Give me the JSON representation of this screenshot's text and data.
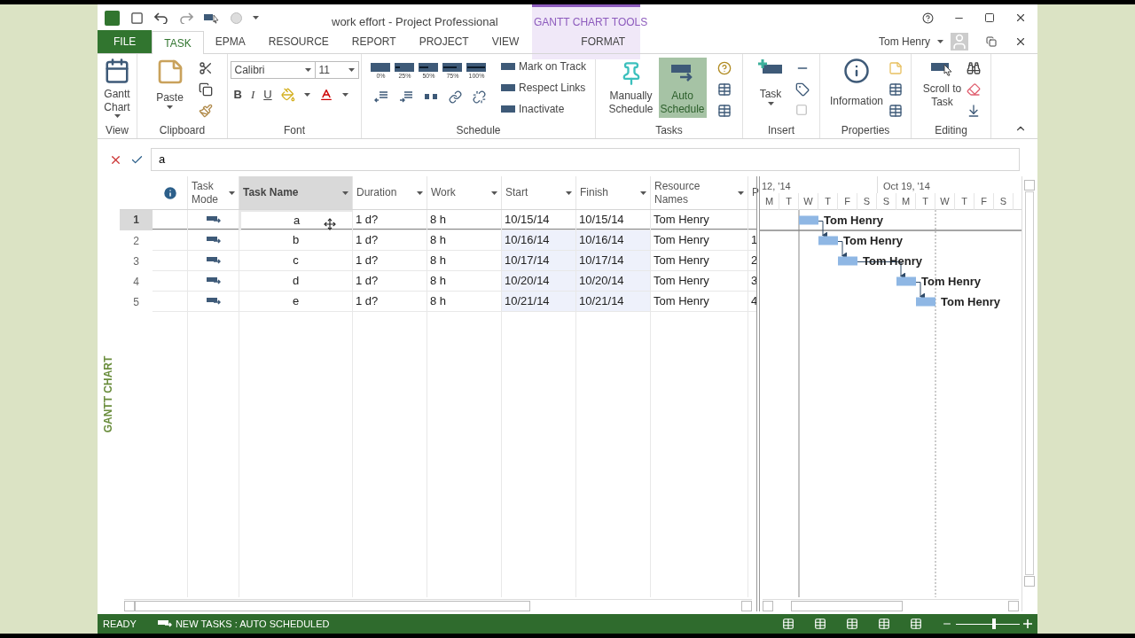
{
  "window": {
    "title": "work effort - Project Professional",
    "context_title": "GANTT CHART TOOLS",
    "user": "Tom Henry"
  },
  "tabs": [
    {
      "label": "FILE",
      "kind": "file",
      "selected": false
    },
    {
      "label": "TASK",
      "kind": "tab",
      "selected": true
    },
    {
      "label": "EPMA",
      "kind": "tab",
      "selected": false
    },
    {
      "label": "RESOURCE",
      "kind": "tab",
      "selected": false
    },
    {
      "label": "REPORT",
      "kind": "tab",
      "selected": false
    },
    {
      "label": "PROJECT",
      "kind": "tab",
      "selected": false
    },
    {
      "label": "VIEW",
      "kind": "tab",
      "selected": false
    },
    {
      "label": "FORMAT",
      "kind": "context",
      "selected": false
    }
  ],
  "ribbon": {
    "view": {
      "label": "View",
      "button": "Gantt Chart"
    },
    "clipboard": {
      "label": "Clipboard",
      "button": "Paste"
    },
    "font": {
      "label": "Font",
      "font_name": "Calibri",
      "font_size": "11",
      "format_buttons": [
        "B",
        "I",
        "U"
      ]
    },
    "schedule": {
      "label": "Schedule",
      "percents": [
        "0%",
        "25%",
        "50%",
        "75%",
        "100%"
      ],
      "commands": [
        "Mark on Track",
        "Respect Links",
        "Inactivate"
      ]
    },
    "tasks": {
      "label": "Tasks",
      "modes": [
        {
          "label": "Manually Schedule",
          "selected": false
        },
        {
          "label": "Auto Schedule",
          "selected": true
        }
      ]
    },
    "insert": {
      "label": "Insert",
      "button": "Task"
    },
    "properties": {
      "label": "Properties",
      "button": "Information"
    },
    "editing": {
      "label": "Editing",
      "button": "Scroll to Task"
    }
  },
  "entry_bar": {
    "value": "a"
  },
  "side_label": "GANTT CHART",
  "table": {
    "columns": [
      {
        "label": "Task Mode",
        "selected": false
      },
      {
        "label": "Task Name",
        "selected": true
      },
      {
        "label": "Duration",
        "selected": false
      },
      {
        "label": "Work",
        "selected": false
      },
      {
        "label": "Start",
        "selected": false
      },
      {
        "label": "Finish",
        "selected": false
      },
      {
        "label": "Resource Names",
        "selected": false
      },
      {
        "label": "P",
        "selected": false
      }
    ],
    "rows": [
      {
        "id": "1",
        "name": "a",
        "duration": "1 d?",
        "work": "8 h",
        "start": "10/15/14",
        "finish": "10/15/14",
        "resource": "Tom Henry",
        "selected": true
      },
      {
        "id": "2",
        "name": "b",
        "duration": "1 d?",
        "work": "8 h",
        "start": "10/16/14",
        "finish": "10/16/14",
        "resource": "Tom Henry",
        "column_10": "1",
        "selected": false
      },
      {
        "id": "3",
        "name": "c",
        "duration": "1 d?",
        "work": "8 h",
        "start": "10/17/14",
        "finish": "10/17/14",
        "resource": "Tom Henry",
        "column_10": "2",
        "selected": false
      },
      {
        "id": "4",
        "name": "d",
        "duration": "1 d?",
        "work": "8 h",
        "start": "10/20/14",
        "finish": "10/20/14",
        "resource": "Tom Henry",
        "column_10": "3",
        "selected": false
      },
      {
        "id": "5",
        "name": "e",
        "duration": "1 d?",
        "work": "8 h",
        "start": "10/21/14",
        "finish": "10/21/14",
        "resource": "Tom Henry",
        "column_10": "4",
        "selected": false
      }
    ]
  },
  "timescale": {
    "weeks": [
      "12, '14",
      "Oct 19, '14"
    ],
    "days": [
      "M",
      "T",
      "W",
      "T",
      "F",
      "S",
      "S",
      "M",
      "T",
      "W",
      "T",
      "F",
      "S"
    ]
  },
  "gantt_bars": [
    {
      "label": "Tom Henry"
    },
    {
      "label": "Tom Henry"
    },
    {
      "label": "Tom Henry"
    },
    {
      "label": "Tom Henry"
    },
    {
      "label": "Tom Henry"
    }
  ],
  "status_bar": {
    "state": "READY",
    "new_tasks": "NEW TASKS : AUTO SCHEDULED",
    "zoom": {
      "level": 0.6
    }
  }
}
